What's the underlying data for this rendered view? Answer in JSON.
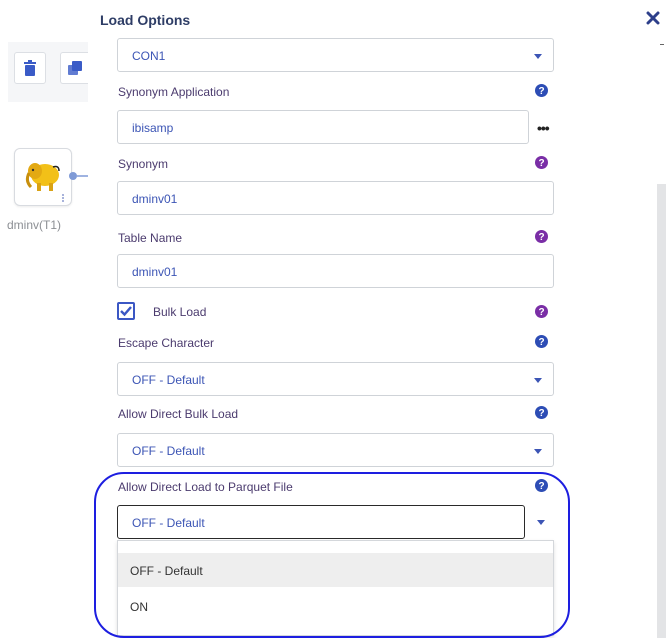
{
  "dialog": {
    "title": "Load Options"
  },
  "canvas": {
    "node_label": "dminv(T1)"
  },
  "fields": {
    "connection": {
      "value": "CON1"
    },
    "synonym_application": {
      "label": "Synonym Application",
      "value": "ibisamp",
      "browse": "•••"
    },
    "synonym": {
      "label": "Synonym",
      "value": "dminv01"
    },
    "table_name": {
      "label": "Table Name",
      "value": "dminv01"
    },
    "bulk_load": {
      "label": "Bulk Load",
      "checked": true
    },
    "escape_character": {
      "label": "Escape Character",
      "value": "OFF - Default"
    },
    "allow_direct_bulk_load": {
      "label": "Allow Direct Bulk Load",
      "value": "OFF - Default"
    },
    "allow_direct_load_parquet": {
      "label": "Allow Direct Load to Parquet File",
      "value": "OFF - Default",
      "options": [
        "OFF - Default",
        "ON"
      ]
    }
  },
  "colors": {
    "accent": "#3b57c4",
    "help_blue": "#2d4db5",
    "help_purple": "#7a2ea6",
    "highlight": "#1d1ee0"
  },
  "icons": [
    "trash-icon",
    "stack-icon",
    "hadoop-elephant-icon",
    "close-icon",
    "help-icon",
    "chevron-down-icon",
    "check-icon",
    "ellipsis-icon"
  ]
}
